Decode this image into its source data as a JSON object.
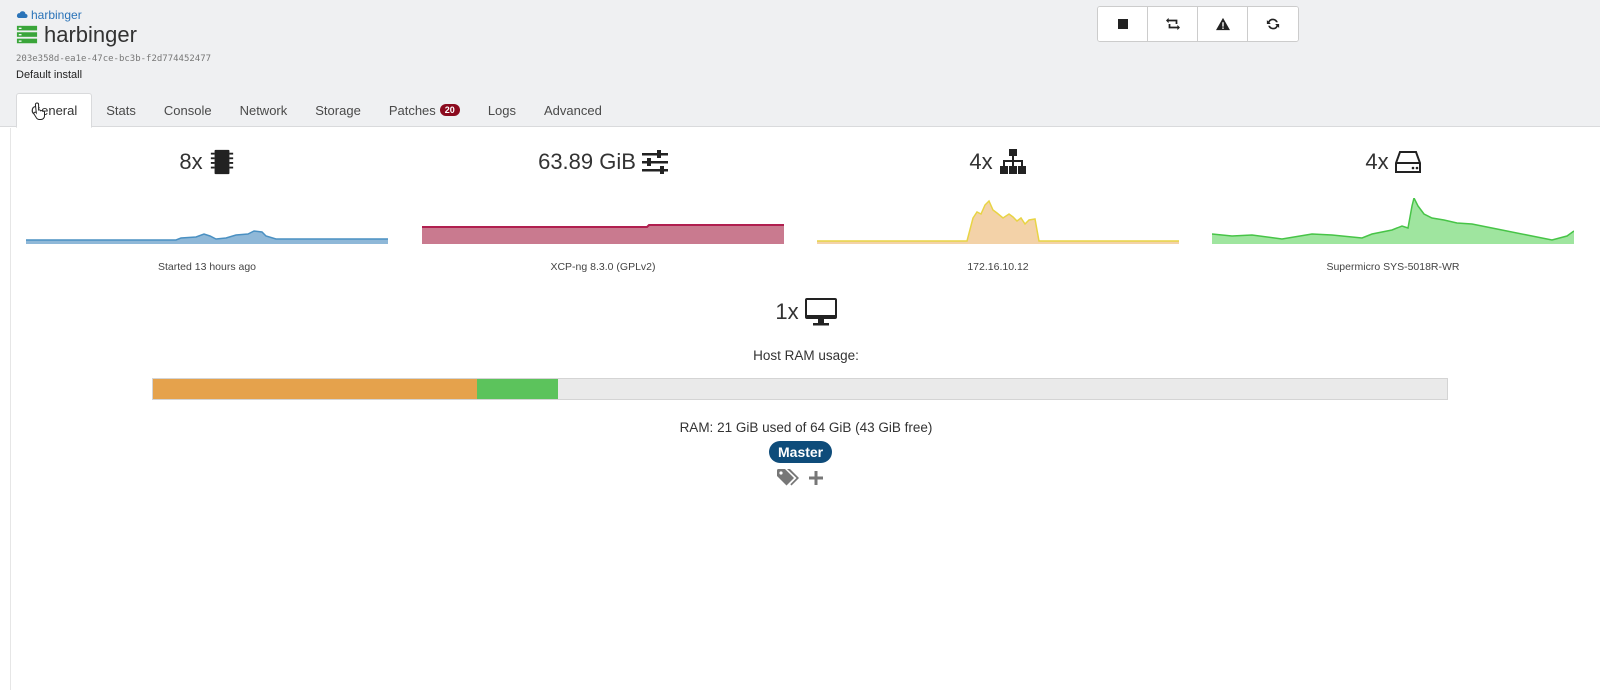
{
  "header": {
    "breadcrumb": "harbinger",
    "title": "harbinger",
    "uuid": "203e358d-ea1e-47ce-bc3b-f2d774452477",
    "description": "Default install"
  },
  "actions": [
    {
      "name": "stop-button",
      "icon": "stop-icon"
    },
    {
      "name": "restart-toolstack-button",
      "icon": "retweet-icon"
    },
    {
      "name": "maintenance-button",
      "icon": "warning-icon"
    },
    {
      "name": "reboot-button",
      "icon": "refresh-icon"
    }
  ],
  "tabs": [
    {
      "label": "General",
      "active": true
    },
    {
      "label": "Stats"
    },
    {
      "label": "Console"
    },
    {
      "label": "Network"
    },
    {
      "label": "Storage"
    },
    {
      "label": "Patches",
      "badge": "20"
    },
    {
      "label": "Logs"
    },
    {
      "label": "Advanced"
    }
  ],
  "stats": {
    "cpu": {
      "value": "8x",
      "caption": "Started 13 hours ago",
      "color": "#4a90c2"
    },
    "memory": {
      "value": "63.89 GiB",
      "caption": "XCP-ng 8.3.0 (GPLv2)",
      "color": "#c2185b"
    },
    "network": {
      "value": "4x",
      "caption": "172.16.10.12",
      "color": "#e8d444"
    },
    "storage": {
      "value": "4x",
      "caption": "Supermicro SYS-5018R-WR",
      "color": "#47c447"
    }
  },
  "vms": {
    "value": "1x"
  },
  "ram": {
    "label": "Host RAM usage:",
    "text": "RAM: 21 GiB used of 64 GiB (43 GiB free)",
    "used_fraction": 0.25,
    "other_fraction": 0.063,
    "used_color": "#e5a24c",
    "other_color": "#5cc35c"
  },
  "master_badge": "Master",
  "icons": {
    "tag": "tags-icon",
    "add": "plus-icon"
  }
}
